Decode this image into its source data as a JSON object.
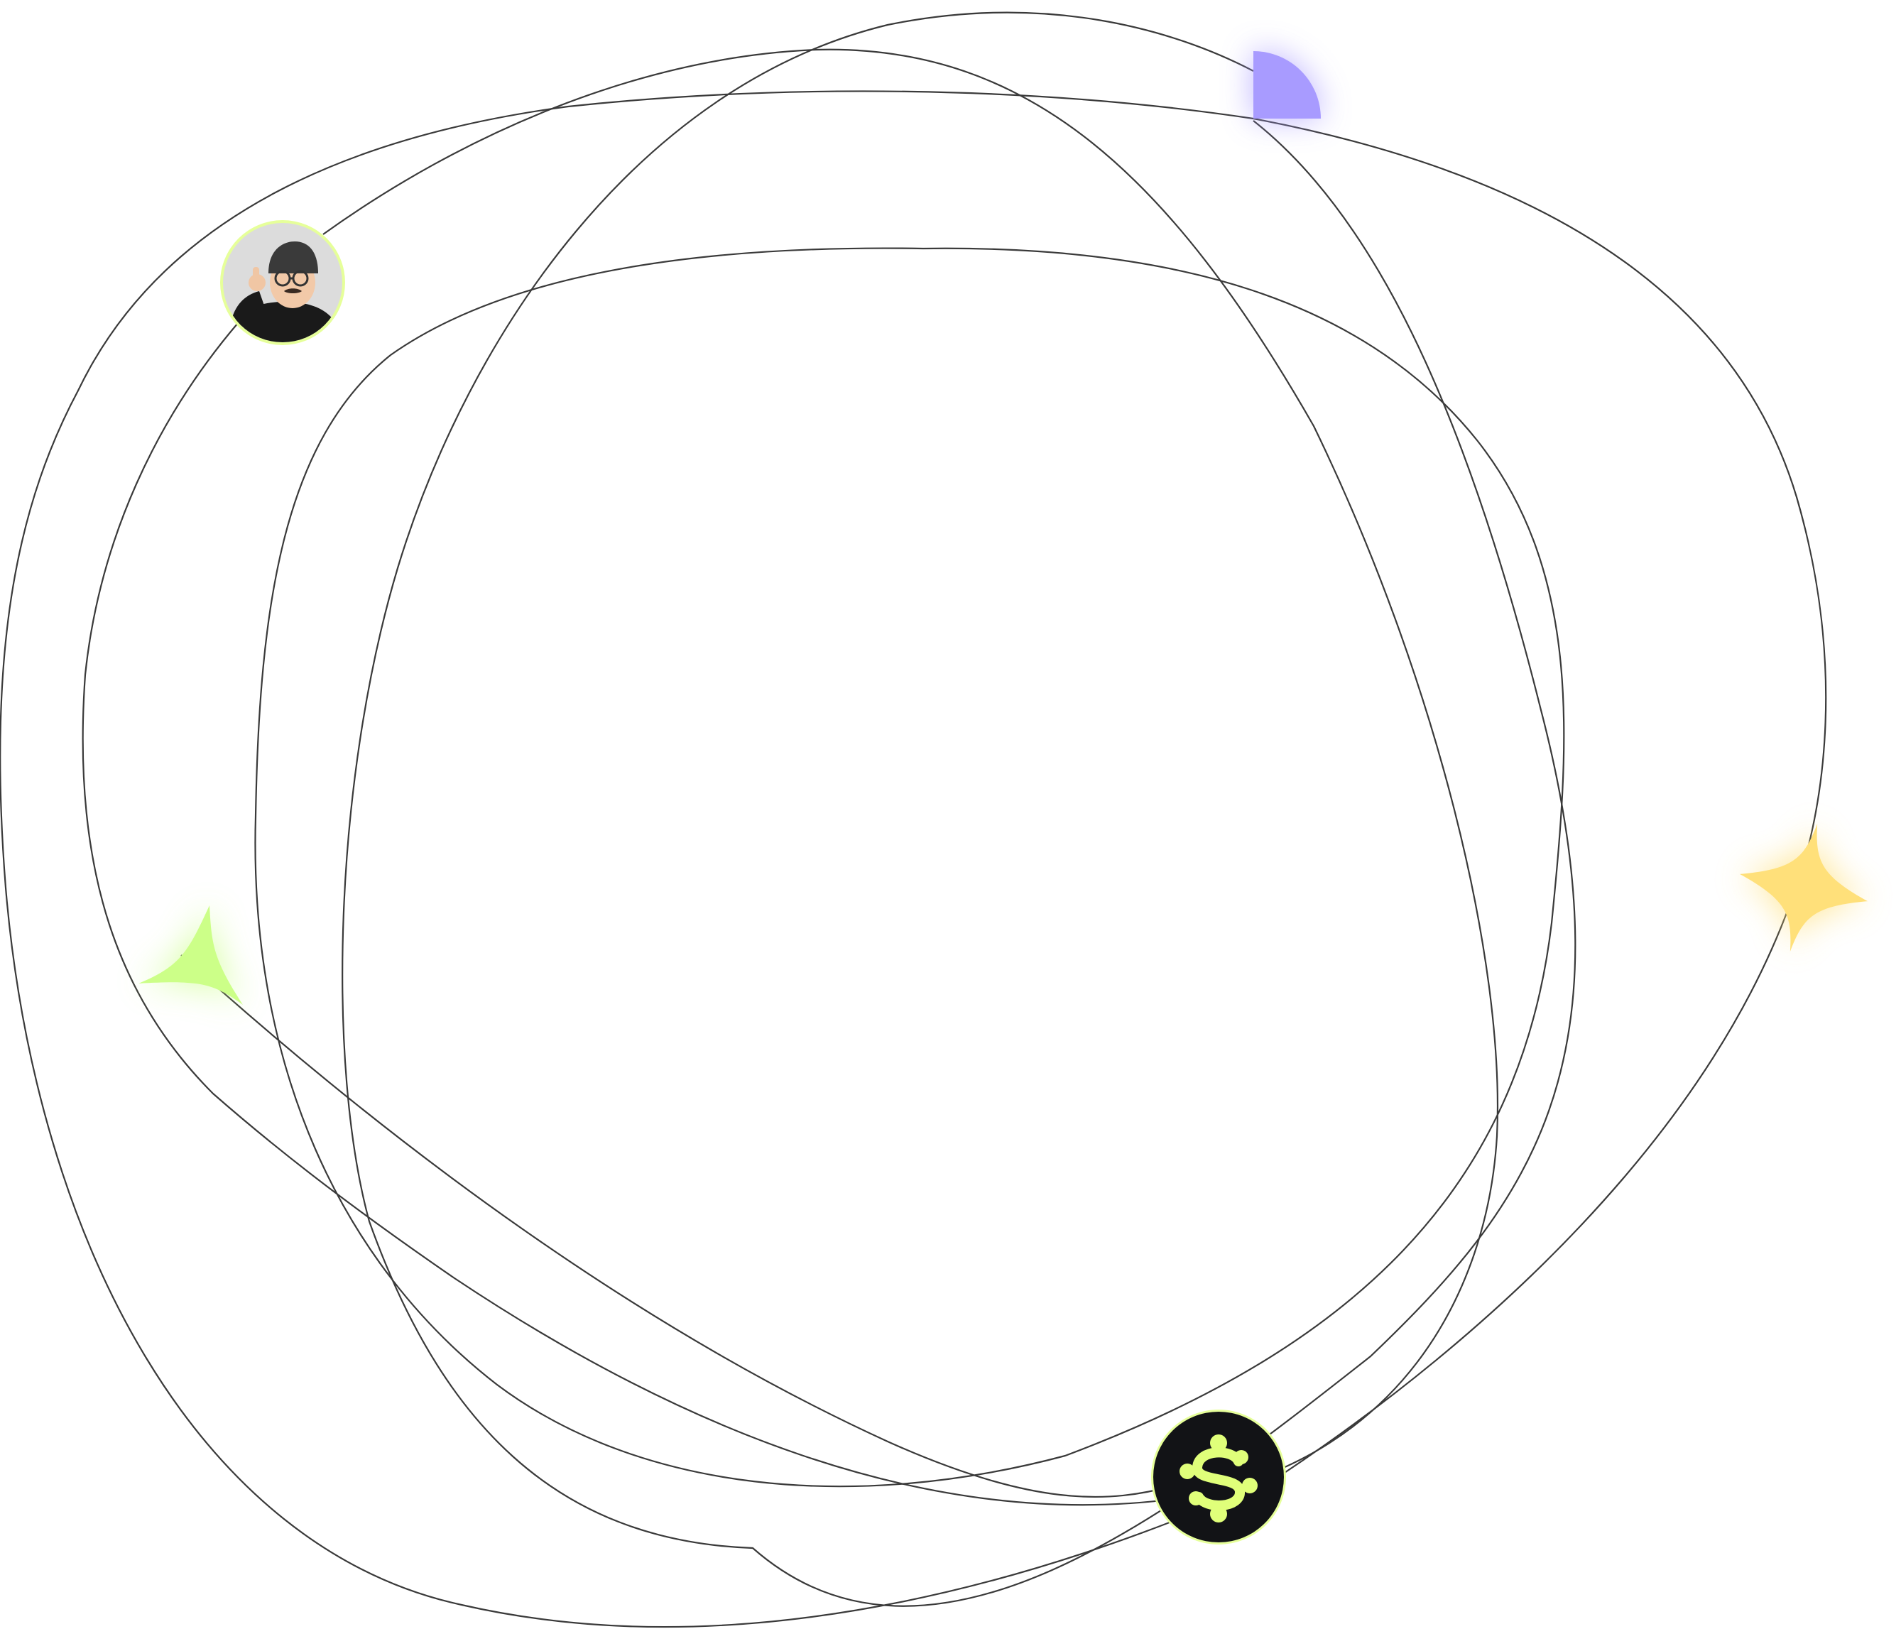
{
  "colors": {
    "background": "#ffffff",
    "orbit_stroke": "#3a3a3a",
    "quarter_circle": "#a89bff",
    "star_yellow": "#ffe07a",
    "star_green": "#ccff88",
    "logo_bg": "#121316",
    "logo_ring": "#e6ff9a",
    "logo_glyph": "#e0ff7a",
    "avatar_ring": "#e6ff9a",
    "avatar_bg": "#dcdcdc"
  },
  "icons": {
    "quarter_circle": "quarter-circle-icon",
    "yellow_star": "four-point-star-icon",
    "green_star": "three-point-star-icon",
    "logo": "s-knot-logo",
    "avatar": "memoji-avatar"
  }
}
